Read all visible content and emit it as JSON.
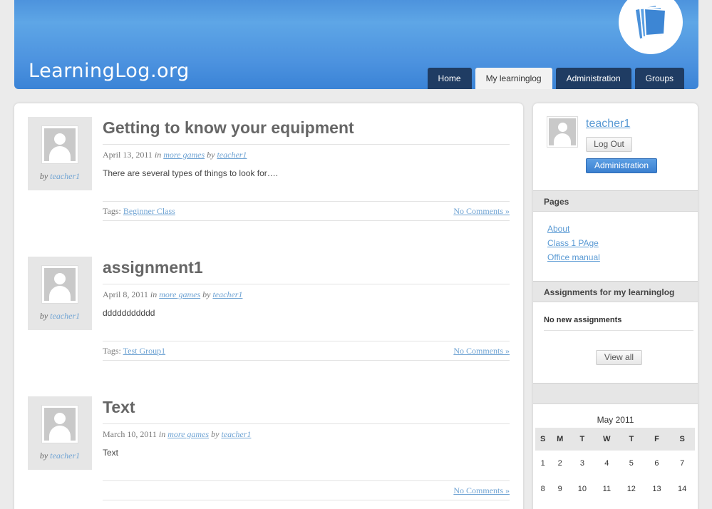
{
  "header": {
    "logo": "LearningLog.org",
    "tabs": [
      {
        "label": "Home",
        "active": false
      },
      {
        "label": "My learninglog",
        "active": true
      },
      {
        "label": "Administration",
        "active": false
      },
      {
        "label": "Groups",
        "active": false
      }
    ]
  },
  "posts": [
    {
      "title": "Getting to know your equipment",
      "date": "April 13, 2011",
      "category": "more games",
      "author": "teacher1",
      "excerpt": "There are several types of things to look for….",
      "tags_label": "Tags:",
      "tag": "Beginner Class",
      "comments": "No Comments »"
    },
    {
      "title": "assignment1",
      "date": "April 8, 2011",
      "category": "more games",
      "author": "teacher1",
      "excerpt": "ddddddddddd",
      "tags_label": "Tags:",
      "tag": "Test Group1",
      "comments": "No Comments »"
    },
    {
      "title": "Text",
      "date": "March 10, 2011",
      "category": "more games",
      "author": "teacher1",
      "excerpt": "Text",
      "tags_label": "",
      "tag": "",
      "comments": "No Comments »"
    }
  ],
  "words": {
    "by": "by",
    "in": "in"
  },
  "sidebar": {
    "username": "teacher1",
    "logout_label": "Log Out",
    "admin_label": "Administration",
    "pages_heading": "Pages",
    "pages": [
      "About",
      "Class 1 PAge",
      "Office manual"
    ],
    "assignments_heading": "Assignments for my learninglog",
    "no_assignments": "No new assignments",
    "view_all_label": "View all",
    "calendar": {
      "month": "May 2011",
      "weekdays": [
        "S",
        "M",
        "T",
        "W",
        "T",
        "F",
        "S"
      ],
      "weeks": [
        [
          "1",
          "2",
          "3",
          "4",
          "5",
          "6",
          "7"
        ],
        [
          "8",
          "9",
          "10",
          "11",
          "12",
          "13",
          "14"
        ]
      ]
    }
  }
}
